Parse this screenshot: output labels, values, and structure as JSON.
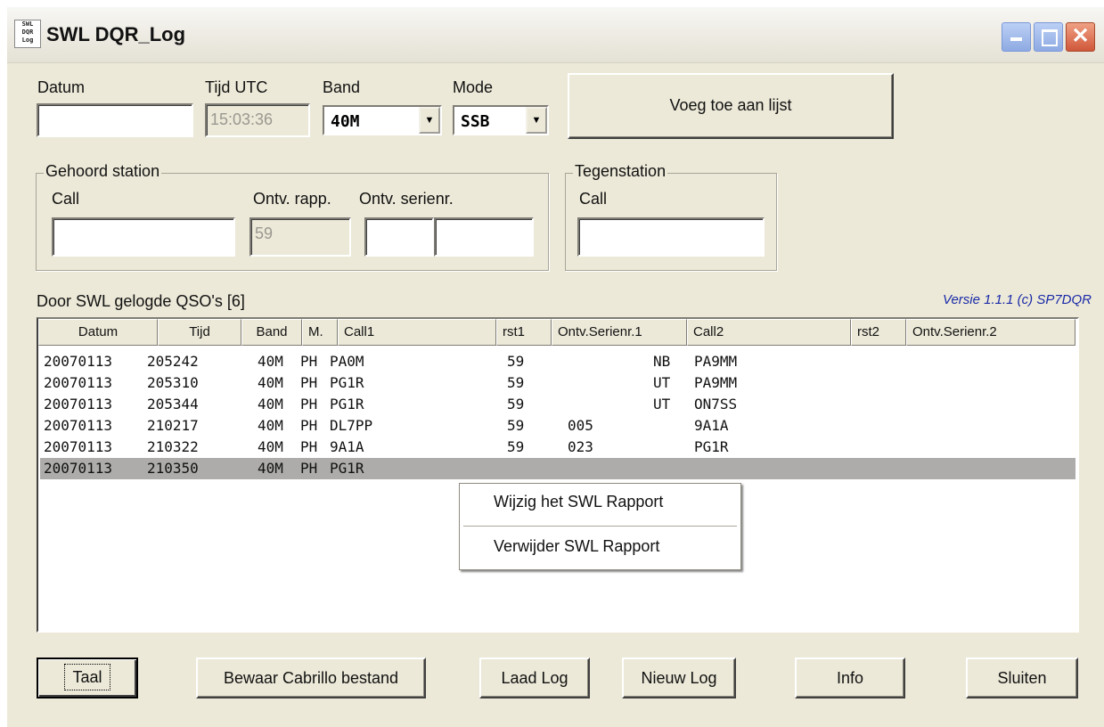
{
  "window": {
    "title": "SWL DQR_Log",
    "icon_text": "SWL DQR Log",
    "controls": {
      "minimize": "minimize-icon",
      "maximize": "maximize-icon",
      "close": "close-icon"
    }
  },
  "top": {
    "datum_label": "Datum",
    "datum_value": "",
    "tijd_label": "Tijd UTC",
    "tijd_value": "15:03:36",
    "band_label": "Band",
    "band_value": "40M",
    "mode_label": "Mode",
    "mode_value": "SSB",
    "add_button": "Voeg toe aan lijst"
  },
  "heard": {
    "group_title": "Gehoord station",
    "call_label": "Call",
    "call_value": "",
    "rapp_label": "Ontv. rapp.",
    "rapp_value": "59",
    "serienr_label": "Ontv. serienr.",
    "serienr_value_1": "",
    "serienr_value_2": ""
  },
  "counter": {
    "group_title": "Tegenstation",
    "call_label": "Call",
    "call_value": ""
  },
  "log": {
    "title": "Door SWL gelogde QSO's  [6]",
    "version": "Versie 1.1.1 (c) SP7DQR",
    "columns": [
      "Datum",
      "Tijd",
      "Band",
      "M.",
      "Call1",
      "rst1",
      "Ontv.Serienr.1",
      "Call2",
      "rst2",
      "Ontv.Serienr.2"
    ],
    "rows": [
      {
        "datum": "20070113",
        "tijd": "205242",
        "band": "40M",
        "mode": "PH",
        "call1": "PA0M",
        "rst1": "59",
        "sn1": "",
        "sn1b": "NB",
        "call2": "PA9MM"
      },
      {
        "datum": "20070113",
        "tijd": "205310",
        "band": "40M",
        "mode": "PH",
        "call1": "PG1R",
        "rst1": "59",
        "sn1": "",
        "sn1b": "UT",
        "call2": "PA9MM"
      },
      {
        "datum": "20070113",
        "tijd": "205344",
        "band": "40M",
        "mode": "PH",
        "call1": "PG1R",
        "rst1": "59",
        "sn1": "",
        "sn1b": "UT",
        "call2": "ON7SS"
      },
      {
        "datum": "20070113",
        "tijd": "210217",
        "band": "40M",
        "mode": "PH",
        "call1": "DL7PP",
        "rst1": "59",
        "sn1": "005",
        "sn1b": "",
        "call2": "9A1A"
      },
      {
        "datum": "20070113",
        "tijd": "210322",
        "band": "40M",
        "mode": "PH",
        "call1": "9A1A",
        "rst1": "59",
        "sn1": "023",
        "sn1b": "",
        "call2": "PG1R"
      },
      {
        "datum": "20070113",
        "tijd": "210350",
        "band": "40M",
        "mode": "PH",
        "call1": "PG1R",
        "rst1": "",
        "sn1": "",
        "sn1b": "",
        "call2": ""
      }
    ]
  },
  "context_menu": {
    "items": [
      "Wijzig het SWL Rapport",
      "Verwijder SWL Rapport"
    ]
  },
  "buttons": {
    "taal": "Taal",
    "cabrillo": "Bewaar Cabrillo bestand",
    "laad": "Laad Log",
    "nieuw": "Nieuw Log",
    "info": "Info",
    "sluiten": "Sluiten"
  }
}
